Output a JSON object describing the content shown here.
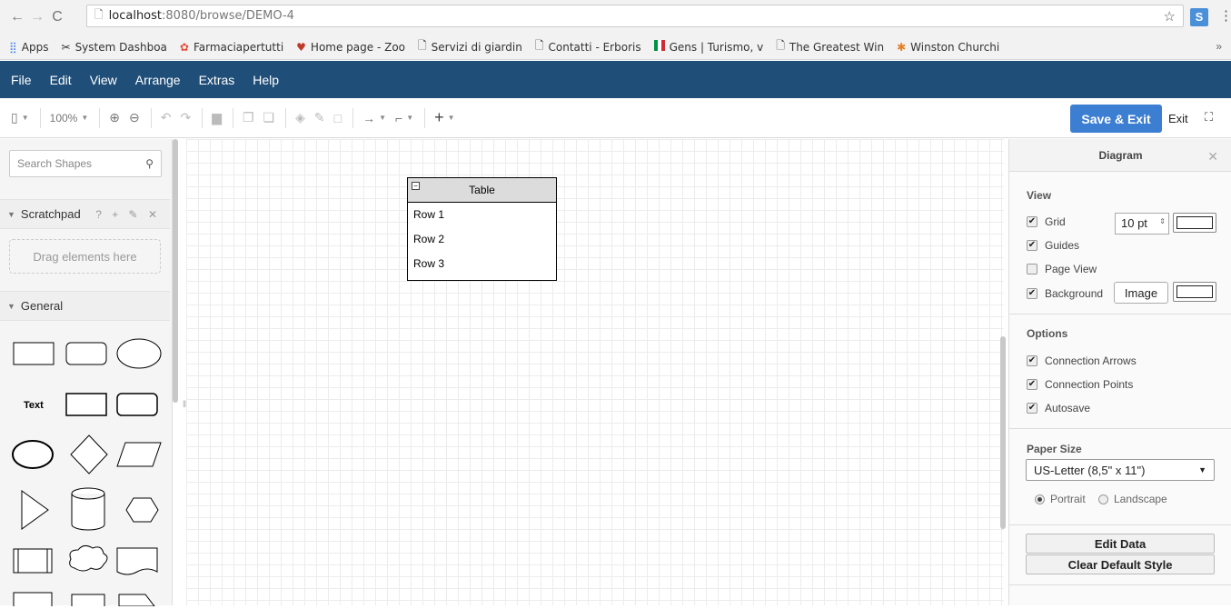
{
  "browser": {
    "url_host": "localhost",
    "url_rest": ":8080/browse/DEMO-4",
    "bookmarks": [
      {
        "icon": "apps-grid-icon",
        "label": "Apps"
      },
      {
        "icon": "dashboard-icon",
        "label": "System Dashboa"
      },
      {
        "icon": "pharmacy-icon",
        "label": "Farmaciapertutti"
      },
      {
        "icon": "flower-icon",
        "label": "Home page - Zoo"
      },
      {
        "icon": "page-icon",
        "label": "Servizi di giardin"
      },
      {
        "icon": "page-icon",
        "label": "Contatti - Erboris"
      },
      {
        "icon": "italy-flag-icon",
        "label": "Gens | Turismo, v"
      },
      {
        "icon": "page-icon",
        "label": "The Greatest Win"
      },
      {
        "icon": "pinwheel-icon",
        "label": "Winston Churchi"
      }
    ],
    "more": "»"
  },
  "menu": [
    "File",
    "Edit",
    "View",
    "Arrange",
    "Extras",
    "Help"
  ],
  "toolbar": {
    "zoom": "100%",
    "save_exit": "Save & Exit",
    "exit": "Exit"
  },
  "sidebar": {
    "search_placeholder": "Search Shapes",
    "scratchpad": "Scratchpad",
    "scratch_icons": "? + ✎ ✕",
    "dropzone": "Drag elements here",
    "general": "General",
    "text_shape": "Text"
  },
  "canvas": {
    "table_title": "Table",
    "rows": [
      "Row 1",
      "Row 2",
      "Row 3"
    ]
  },
  "panel": {
    "title": "Diagram",
    "view_header": "View",
    "grid": "Grid",
    "grid_size": "10 pt",
    "guides": "Guides",
    "page_view": "Page View",
    "background": "Background",
    "image_btn": "Image",
    "options_header": "Options",
    "connection_arrows": "Connection Arrows",
    "connection_points": "Connection Points",
    "autosave": "Autosave",
    "paper_header": "Paper Size",
    "paper_value": "US-Letter (8,5\" x 11\")",
    "portrait": "Portrait",
    "landscape": "Landscape",
    "edit_data": "Edit Data",
    "clear_style": "Clear Default Style"
  },
  "colors": {
    "menubar": "#1f4e79",
    "save_button": "#3b7ed2"
  }
}
